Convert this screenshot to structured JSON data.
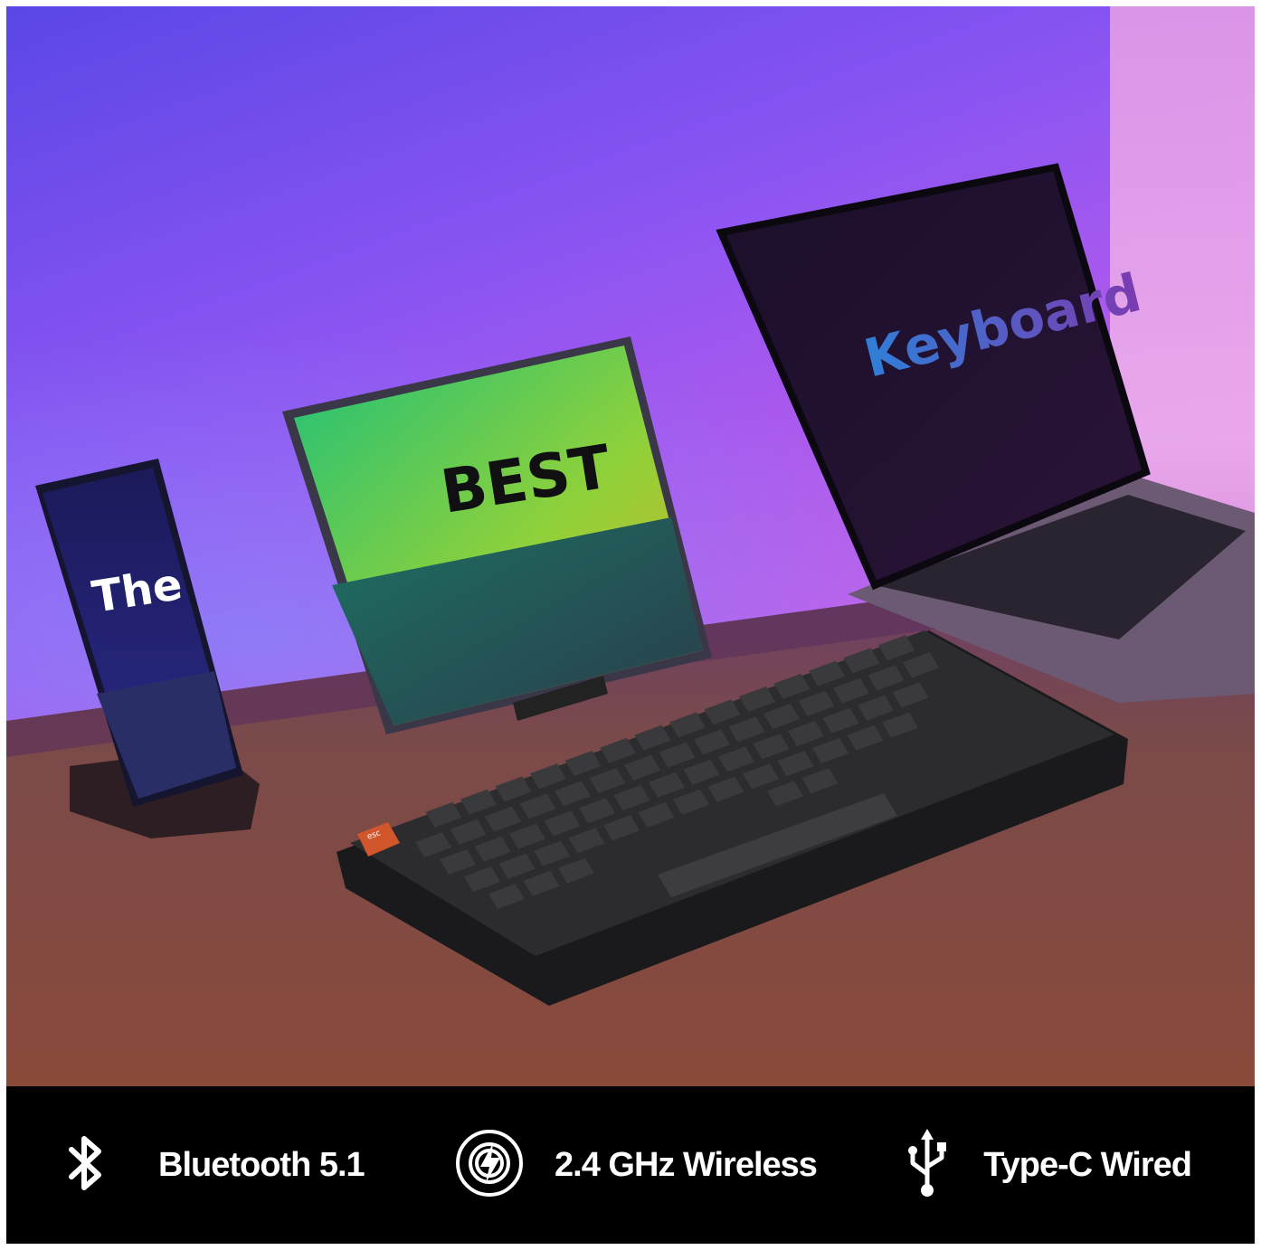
{
  "scene": {
    "phone_text": "The",
    "tablet_text": "BEST",
    "laptop_text": "Keyboard",
    "esc_key_label": "esc"
  },
  "features": [
    {
      "icon": "bluetooth-icon",
      "label": "Bluetooth 5.1"
    },
    {
      "icon": "wireless-signal-icon",
      "label": "2.4 GHz Wireless"
    },
    {
      "icon": "usb-icon",
      "label": "Type-C Wired"
    }
  ],
  "colors": {
    "bar_background": "#000000",
    "label_text": "#ffffff",
    "esc_key": "#d2562b",
    "keycap": "#3a3a3c"
  }
}
